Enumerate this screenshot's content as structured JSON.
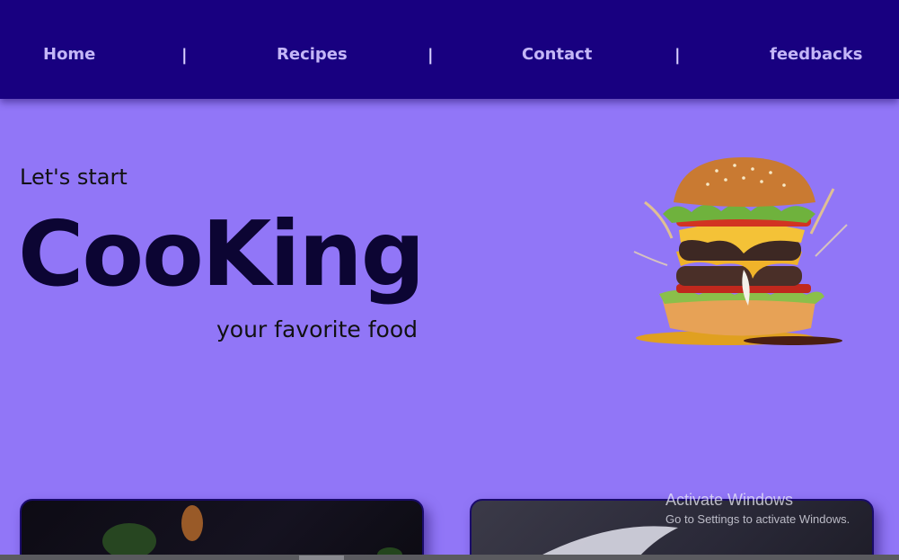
{
  "nav": {
    "items": [
      "Home",
      "Recipes",
      "Contact",
      "feedbacks"
    ],
    "separator": "|"
  },
  "hero": {
    "intro": "Let's start",
    "title": "CooKing",
    "subtitle": "your favorite food"
  },
  "watermark": {
    "title": "Activate Windows",
    "subtitle": "Go to Settings to activate Windows."
  },
  "colors": {
    "nav_bg": "#180080",
    "page_bg": "#9176f7",
    "nav_text": "#c4b6f7",
    "title_text": "#0c0533"
  },
  "icons": [
    "burger-image"
  ]
}
